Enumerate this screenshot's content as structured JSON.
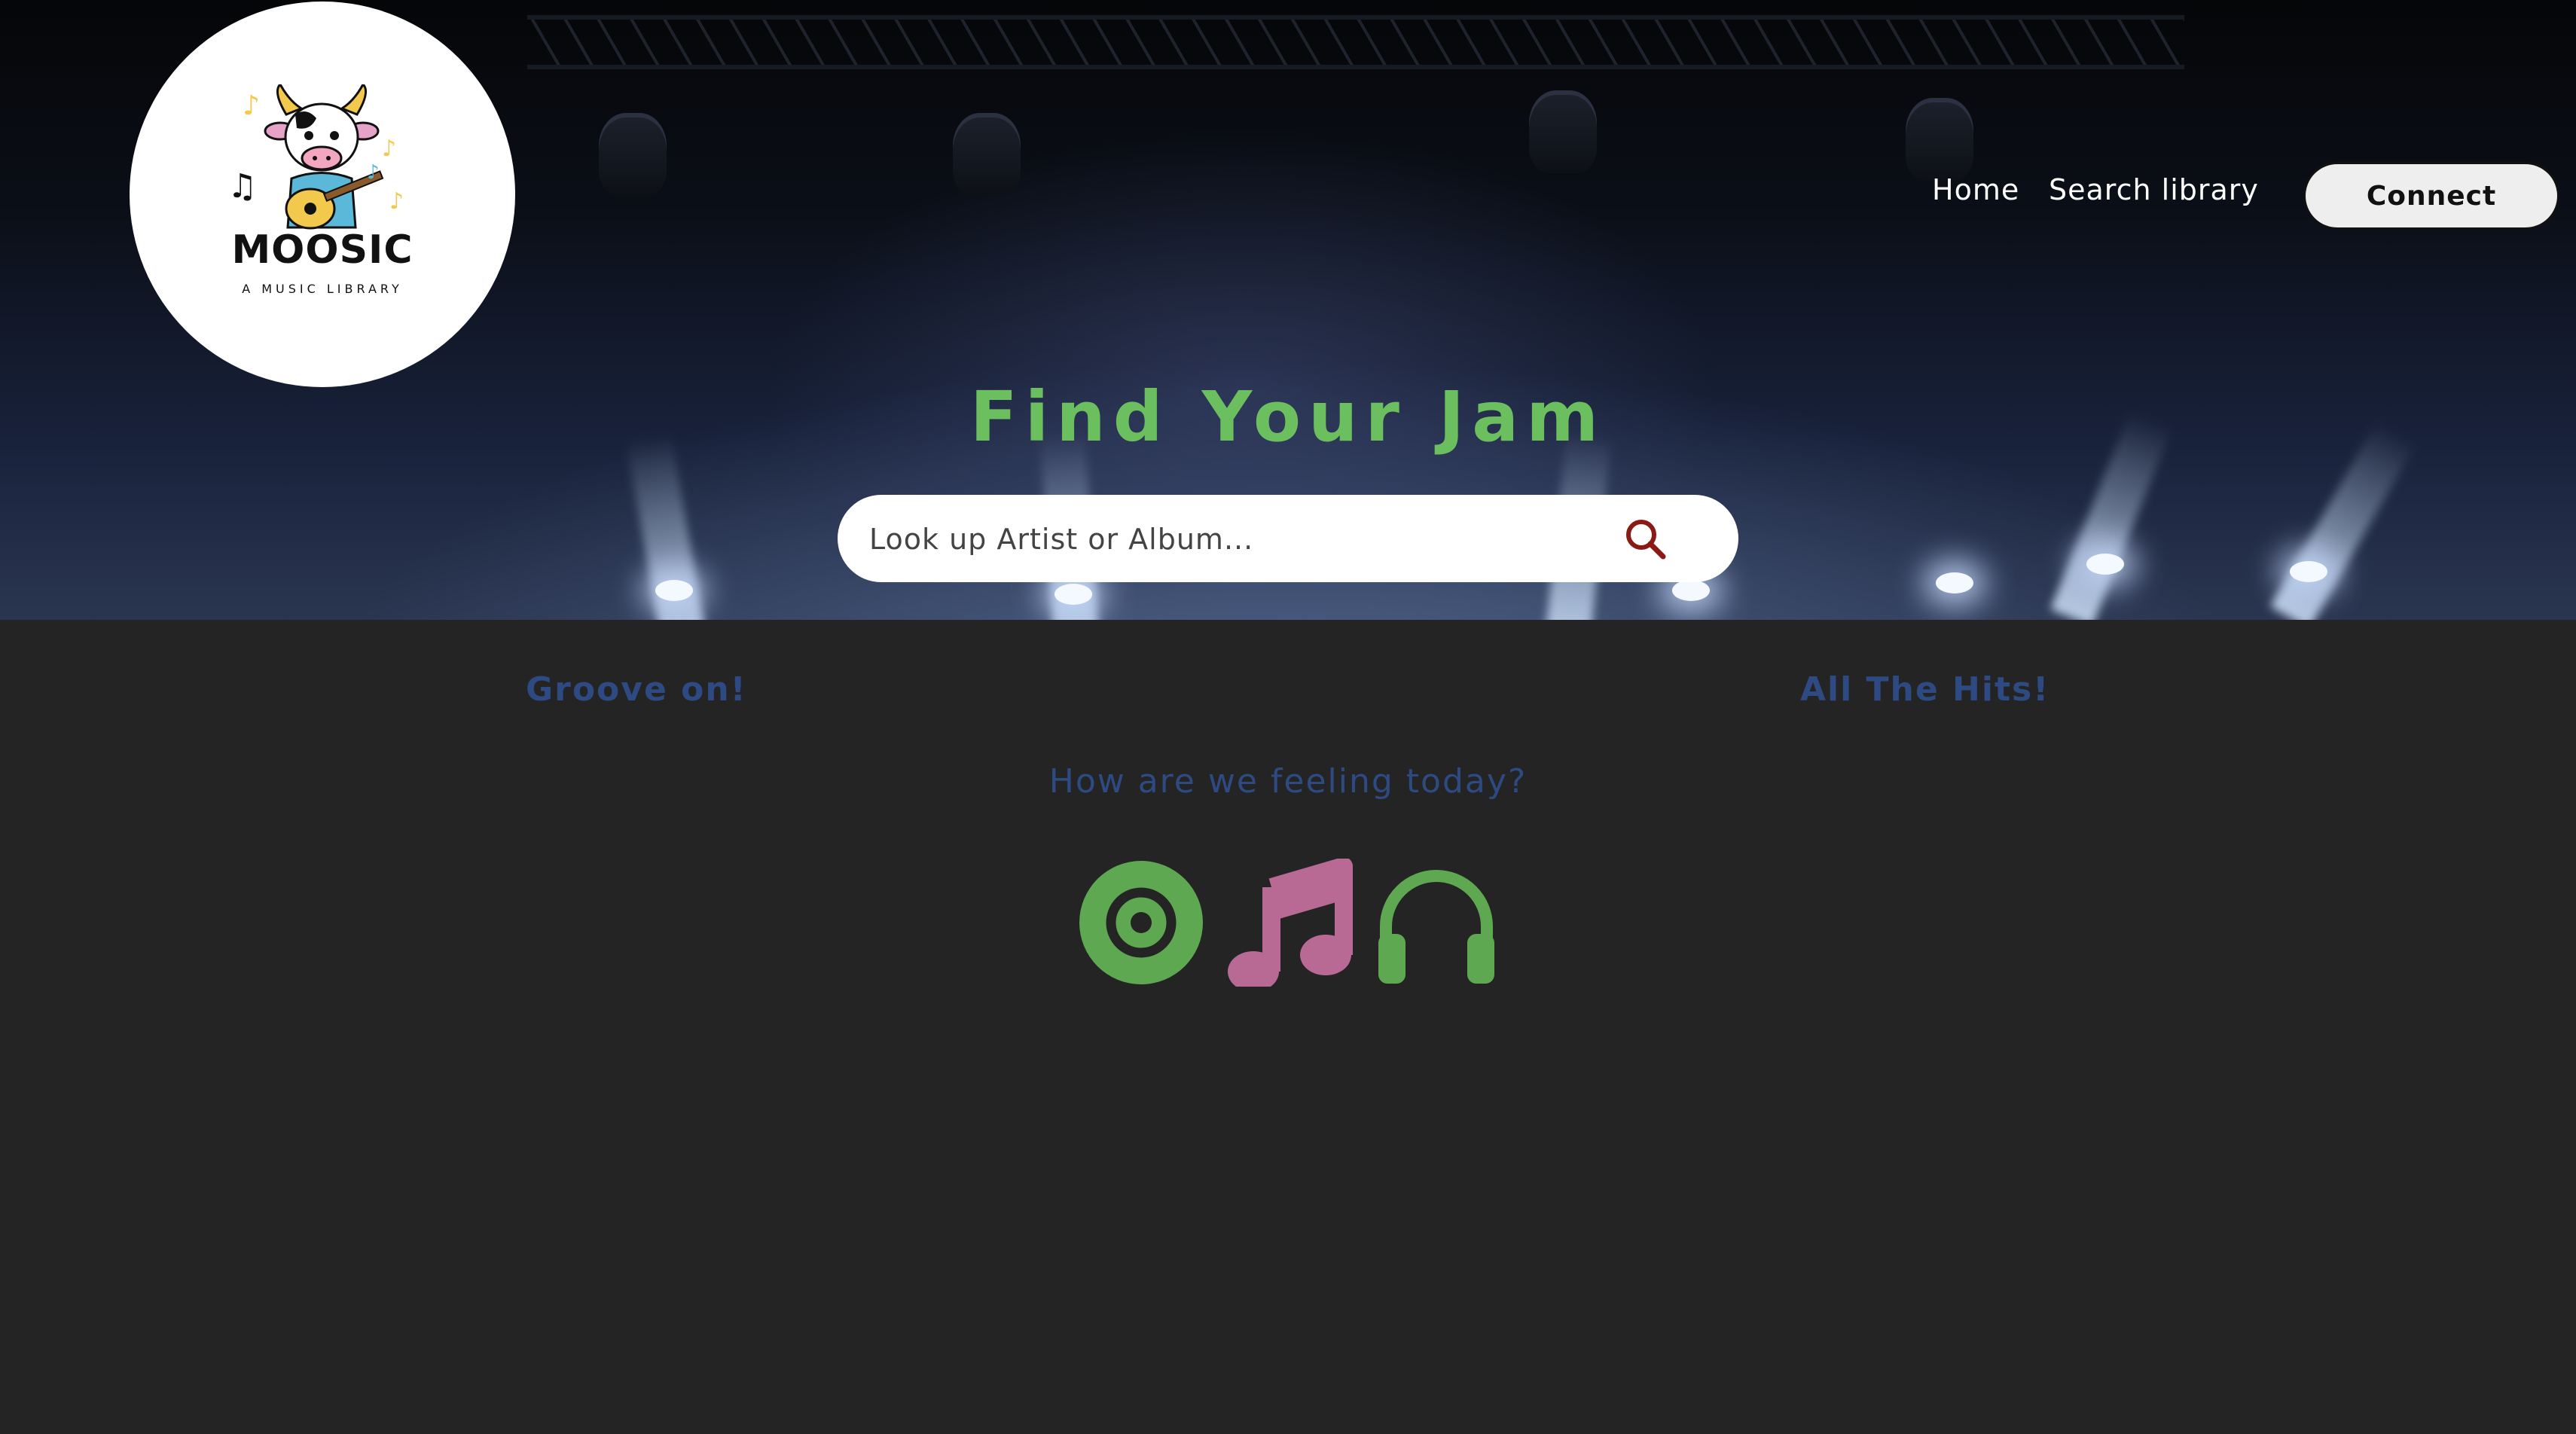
{
  "logo": {
    "name": "MOOSIC",
    "tagline": "A MUSIC LIBRARY"
  },
  "nav": {
    "items": [
      {
        "label": "Home"
      },
      {
        "label": "Search library"
      }
    ],
    "connect_label": "Connect"
  },
  "hero": {
    "headline": "Find Your Jam",
    "search_placeholder": "Look up Artist or Album...",
    "search_icon": "search-icon"
  },
  "sections": {
    "left_heading": "Groove on!",
    "right_heading": "All The Hits!",
    "mood_question": "How are we feeling today?"
  },
  "moods": [
    {
      "icon": "disc-icon",
      "color": "#5fa852"
    },
    {
      "icon": "music-note-icon",
      "color": "#b86a95"
    },
    {
      "icon": "headphones-icon",
      "color": "#5fa852"
    }
  ],
  "colors": {
    "background": "#242424",
    "headline": "#6cbf5e",
    "section_text": "#2e4a82",
    "search_icon": "#8a1a14",
    "button_bg": "#eeeeee"
  }
}
